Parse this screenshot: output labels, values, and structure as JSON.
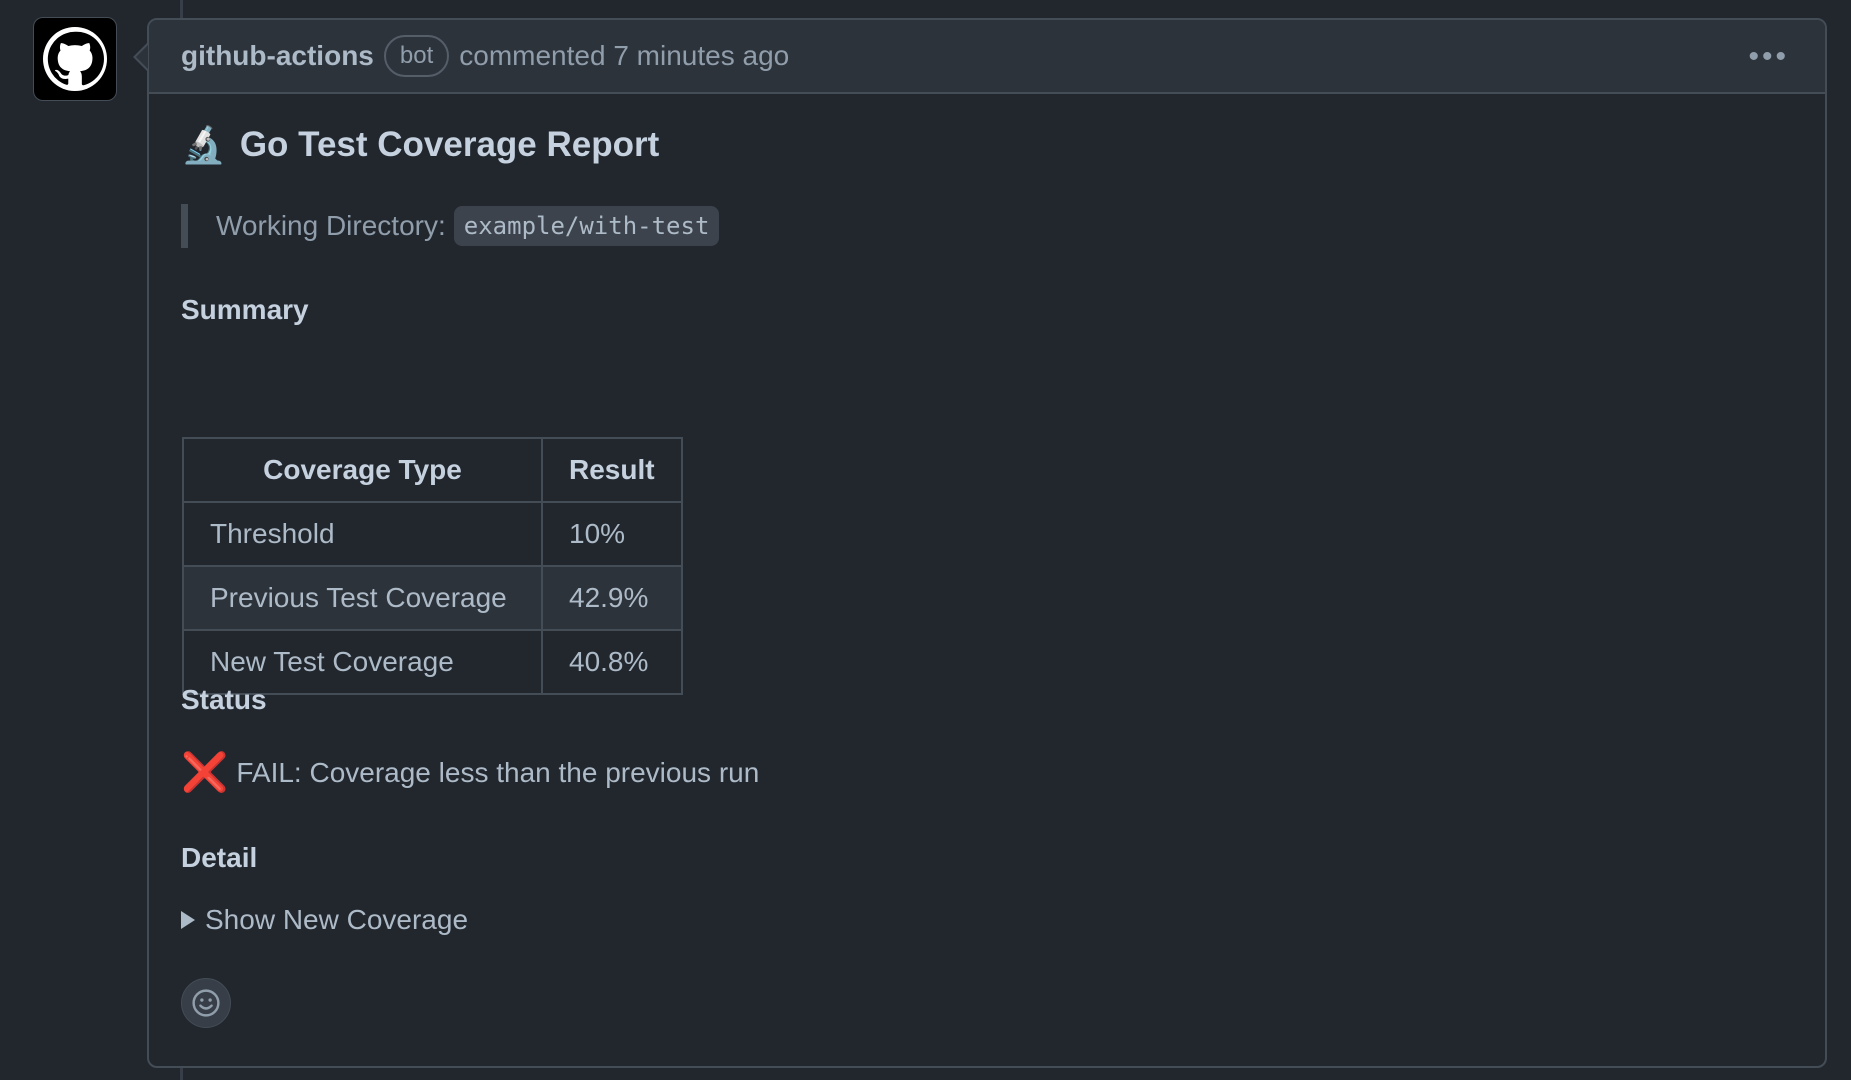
{
  "comment": {
    "author": "github-actions",
    "badge": "bot",
    "meta": "commented 7 minutes ago",
    "menu_icon": "kebab-horizontal-icon"
  },
  "report": {
    "title_emoji": "🔬",
    "title": "Go Test Coverage Report",
    "working_dir_label": "Working Directory:",
    "working_dir": "example/with-test"
  },
  "summary": {
    "heading": "Summary",
    "headers": [
      "Coverage Type",
      "Result"
    ],
    "rows": [
      [
        "Threshold",
        "10%"
      ],
      [
        "Previous Test Coverage",
        "42.9%"
      ],
      [
        "New Test Coverage",
        "40.8%"
      ]
    ]
  },
  "status": {
    "heading": "Status",
    "icon": "❌",
    "text": "FAIL: Coverage less than the previous run"
  },
  "detail": {
    "heading": "Detail",
    "summary_text": "Show New Coverage"
  },
  "colors": {
    "background": "#22272e",
    "header": "#2d333b",
    "border": "#444c56",
    "fail": "#e5534b"
  }
}
